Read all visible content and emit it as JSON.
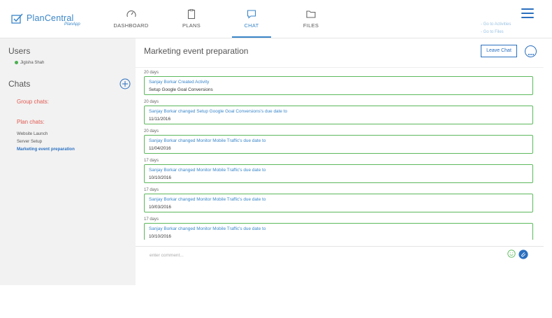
{
  "brand": {
    "name": "PlanCentral",
    "sub": "PlanApp"
  },
  "nav": [
    {
      "label": "DASHBOARD",
      "icon": "dashboard-gauge-icon"
    },
    {
      "label": "PLANS",
      "icon": "clipboard-icon"
    },
    {
      "label": "CHAT",
      "icon": "chat-bubble-icon",
      "active": true
    },
    {
      "label": "FILES",
      "icon": "folder-icon"
    }
  ],
  "header_links": {
    "activities": "- Go to Activities",
    "files": "- Go to Files"
  },
  "sidebar": {
    "users_heading": "Users",
    "users": [
      {
        "name": "Jigisha Shah",
        "status": "online"
      }
    ],
    "chats_heading": "Chats",
    "group_chats_heading": "Group chats:",
    "plan_chats_heading": "Plan chats:",
    "plan_chats": [
      {
        "label": "Website Launch"
      },
      {
        "label": "Server Setup"
      },
      {
        "label": "Marketing event preparation",
        "active": true
      }
    ]
  },
  "main": {
    "title": "Marketing event preparation",
    "leave_label": "Leave Chat",
    "feed": [
      {
        "age": "20 days",
        "text": "Sanjay Borkar Created Activity",
        "detail": "Setup Google Goal Conversions"
      },
      {
        "age": "20 days",
        "text": "Sanjay Borkar changed Setup Google Goal Conversions's due date to",
        "detail": "11/11/2016"
      },
      {
        "age": "20 days",
        "text": "Sanjay Borkar changed Monitor Mobile Traffic's due date to",
        "detail": "11/04/2016"
      },
      {
        "age": "17 days",
        "text": "Sanjay Borkar changed Monitor Mobile Traffic's due date to",
        "detail": "10/10/2016"
      },
      {
        "age": "17 days",
        "text": "Sanjay Borkar changed Monitor Mobile Traffic's due date to",
        "detail": "10/03/2016"
      },
      {
        "age": "17 days",
        "text": "Sanjay Borkar changed Monitor Mobile Traffic's due date to",
        "detail": "10/10/2016"
      }
    ],
    "comment_placeholder": "enter comment..."
  },
  "colors": {
    "accent": "#2a6fbf",
    "link": "#3a86c8",
    "card_border": "#5cb85c",
    "group_heading": "#e0574f",
    "sidebar_bg": "#f2f2f2",
    "online": "#4caf50"
  }
}
